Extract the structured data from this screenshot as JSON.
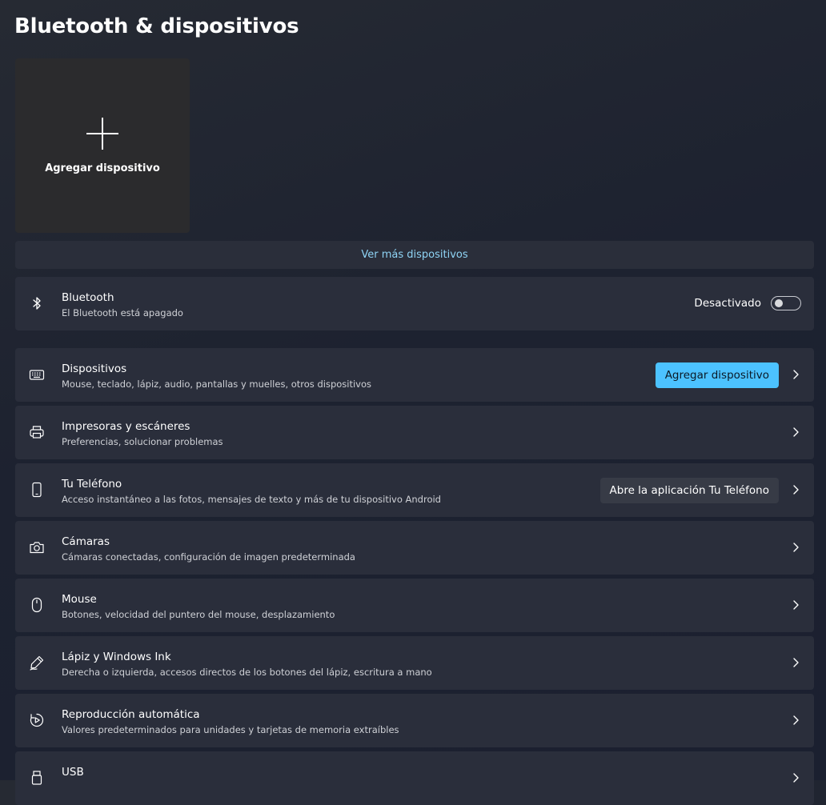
{
  "page": {
    "title": "Bluetooth & dispositivos"
  },
  "add_tile": {
    "label": "Agregar dispositivo"
  },
  "more_devices": {
    "label": "Ver más dispositivos"
  },
  "bluetooth": {
    "title": "Bluetooth",
    "subtitle": "El Bluetooth está apagado",
    "toggle_label": "Desactivado",
    "state": "off"
  },
  "rows": {
    "devices": {
      "title": "Dispositivos",
      "subtitle": "Mouse, teclado, lápiz, audio, pantallas y muelles, otros dispositivos",
      "button": "Agregar dispositivo"
    },
    "printers": {
      "title": "Impresoras y escáneres",
      "subtitle": "Preferencias, solucionar problemas"
    },
    "phone": {
      "title": "Tu Teléfono",
      "subtitle": "Acceso instantáneo a las fotos, mensajes de texto y más de tu dispositivo Android",
      "button": "Abre la aplicación Tu Teléfono"
    },
    "cameras": {
      "title": "Cámaras",
      "subtitle": "Cámaras conectadas, configuración de imagen predeterminada"
    },
    "mouse": {
      "title": "Mouse",
      "subtitle": "Botones, velocidad del puntero del mouse, desplazamiento"
    },
    "pen": {
      "title": "Lápiz y Windows Ink",
      "subtitle": "Derecha o izquierda, accesos directos de los botones del lápiz, escritura a mano"
    },
    "autoplay": {
      "title": "Reproducción automática",
      "subtitle": "Valores predeterminados para unidades y tarjetas de memoria extraíbles"
    },
    "usb": {
      "title": "USB"
    }
  },
  "colors": {
    "accent": "#4cc2ff",
    "link": "#8fd4f5",
    "card": "#2a2e3b"
  }
}
